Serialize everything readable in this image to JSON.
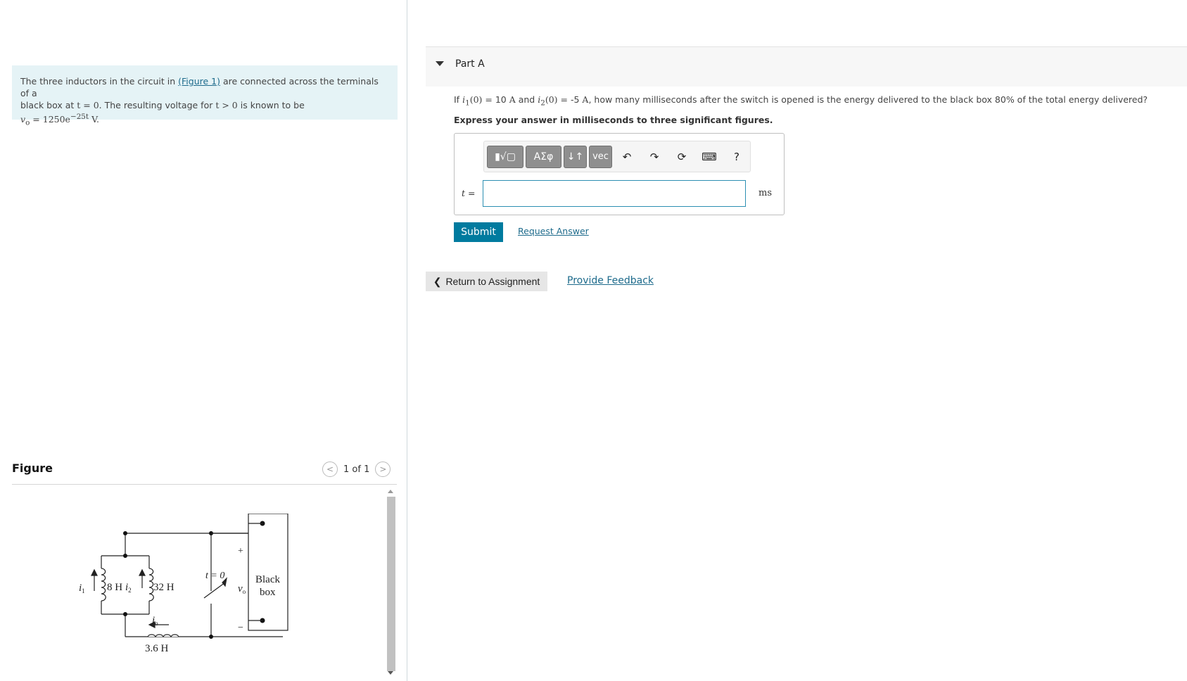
{
  "problem": {
    "text1": "The three inductors in the circuit in ",
    "figure_link": "(Figure 1)",
    "text2": " are connected across the terminals of a",
    "text3": "black box at ",
    "t_eq_0": "t = 0",
    "text4": ". The resulting voltage for ",
    "t_gt_0": "t > 0",
    "text5": " is known to be",
    "voltage_eq": "v",
    "voltage_sub": "o",
    "voltage_rhs": " = 1250e",
    "voltage_exp": "−25t",
    "voltage_unit": " V."
  },
  "figure": {
    "title": "Figure",
    "pager": "1 of 1",
    "labels": {
      "i1": "i",
      "i1_sub": "1",
      "l1": "8 H",
      "i2": "i",
      "i2_sub": "2",
      "l2": "32 H",
      "io": "i",
      "io_sub": "o",
      "l3": "3.6 H",
      "switch": "t = 0",
      "vo": "v",
      "vo_sub": "o",
      "plus": "+",
      "minus": "−",
      "box_line1": "Black",
      "box_line2": "box"
    }
  },
  "part": {
    "title": "Part A",
    "question_pre": "If ",
    "i1": "i",
    "i1_sub": "1",
    "i1_val": "(0)",
    "eq1": " = 10 ",
    "unitA1": "A",
    "and": " and ",
    "i2": "i",
    "i2_sub": "2",
    "i2_val": "(0)",
    "eq2": " = -5 ",
    "unitA2": "A",
    "question_post": ", how many milliseconds after the switch is opened is the energy delivered to the black box 80% of the total energy delivered?",
    "instruction": "Express your answer in milliseconds to three significant figures.",
    "toolbar": {
      "templates": "▮√▢",
      "greek": "ΑΣφ",
      "arrows": "↓↑",
      "vec": "vec",
      "undo": "↶",
      "redo": "↷",
      "reset": "⟳",
      "keyboard": "⌨",
      "help": "?"
    },
    "answer_label": "t",
    "answer_eq": " =",
    "answer_value": "",
    "unit": "ms",
    "submit": "Submit",
    "request": "Request Answer"
  },
  "footer": {
    "return": "Return to Assignment",
    "feedback": "Provide Feedback"
  }
}
